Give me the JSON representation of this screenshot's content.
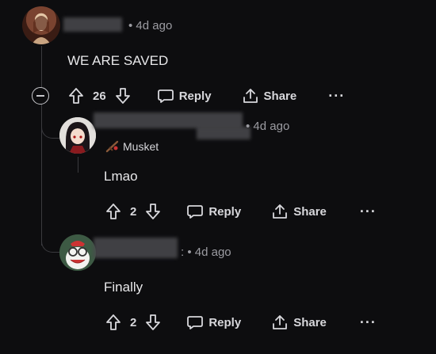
{
  "comments": [
    {
      "time": "• 4d ago",
      "text": "WE ARE SAVED",
      "votes": "26",
      "reply_label": "Reply",
      "share_label": "Share",
      "more_label": "···"
    },
    {
      "time": "• 4d ago",
      "flair": "Musket",
      "text": "Lmao",
      "votes": "2",
      "reply_label": "Reply",
      "share_label": "Share",
      "more_label": "···"
    },
    {
      "time": ": • 4d ago",
      "text": "Finally",
      "votes": "2",
      "reply_label": "Reply",
      "share_label": "Share",
      "more_label": "···"
    }
  ]
}
